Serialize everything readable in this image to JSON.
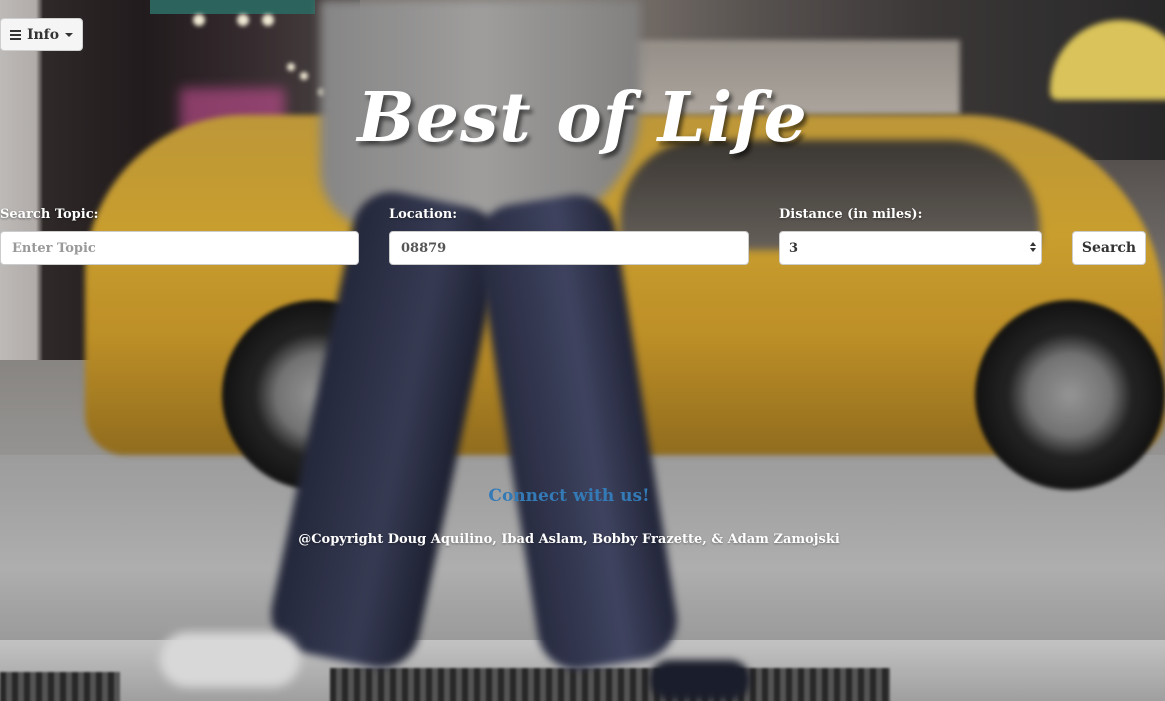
{
  "menu": {
    "label": "Info",
    "icon": "hamburger-icon",
    "caret_icon": "caret-down-icon"
  },
  "header": {
    "title": "Best of Life"
  },
  "form": {
    "topic": {
      "label": "Search Topic:",
      "value": "",
      "placeholder": "Enter Topic"
    },
    "location": {
      "label": "Location:",
      "value": "08879",
      "placeholder": ""
    },
    "distance": {
      "label": "Distance (in miles):",
      "selected": "3",
      "icon": "select-arrows-icon"
    },
    "search_button": "Search"
  },
  "footer": {
    "connect_link": "Connect with us!",
    "copyright": "@Copyright Doug Aquilino, Ibad Aslam, Bobby Frazette, & Adam Zamojski"
  },
  "colors": {
    "link": "#337ab7",
    "text_light": "#ffffff"
  }
}
